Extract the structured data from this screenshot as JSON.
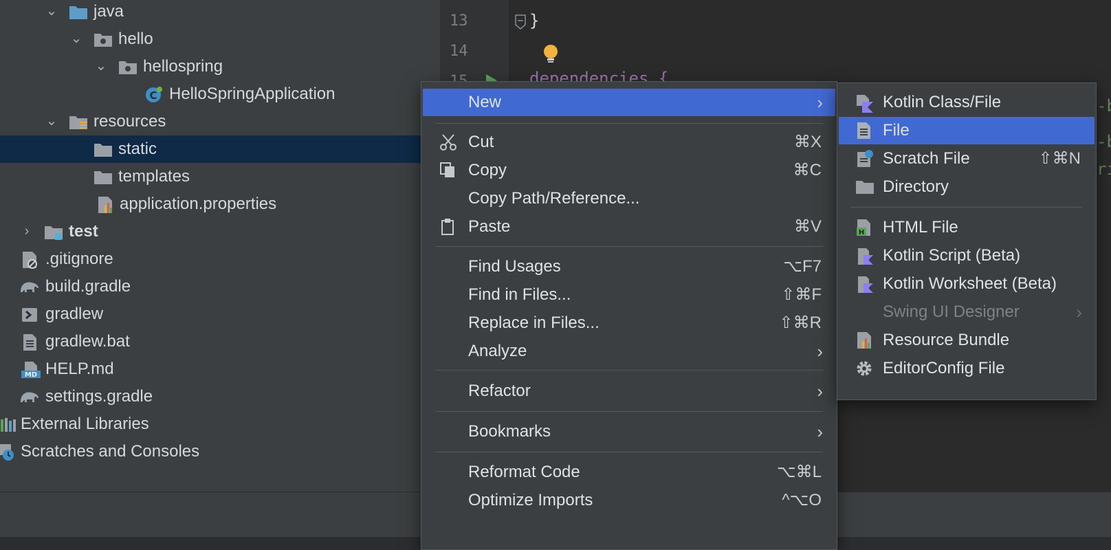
{
  "tree": [
    {
      "label": "java",
      "chev": "⌄",
      "bold": false
    },
    {
      "label": "hello",
      "chev": "⌄",
      "bold": false
    },
    {
      "label": "hellospring",
      "chev": "⌄",
      "bold": false
    },
    {
      "label": "HelloSpringApplication",
      "chev": "",
      "bold": false
    },
    {
      "label": "resources",
      "chev": "⌄",
      "bold": false
    },
    {
      "label": "static",
      "chev": "",
      "bold": false
    },
    {
      "label": "templates",
      "chev": "",
      "bold": false
    },
    {
      "label": "application.properties",
      "chev": "",
      "bold": false
    },
    {
      "label": "test",
      "chev": "›",
      "bold": true
    },
    {
      "label": ".gitignore",
      "chev": "",
      "bold": false
    },
    {
      "label": "build.gradle",
      "chev": "",
      "bold": false
    },
    {
      "label": "gradlew",
      "chev": "",
      "bold": false
    },
    {
      "label": "gradlew.bat",
      "chev": "",
      "bold": false
    },
    {
      "label": "HELP.md",
      "chev": "",
      "bold": false
    },
    {
      "label": "settings.gradle",
      "chev": "",
      "bold": false
    },
    {
      "label": "External Libraries",
      "chev": "",
      "bold": false
    },
    {
      "label": "Scratches and Consoles",
      "chev": "",
      "bold": false
    }
  ],
  "editor": {
    "lines": [
      "13",
      "14",
      "15"
    ],
    "brace": "}",
    "code15": "dependencies {",
    "right1": "-b",
    "right2": "-b",
    "right3": "ri"
  },
  "context_menu": {
    "items": [
      {
        "label": "New",
        "shortcut": "",
        "submenu": true
      },
      {
        "label": "Cut",
        "shortcut": "⌘X",
        "submenu": false
      },
      {
        "label": "Copy",
        "shortcut": "⌘C",
        "submenu": false
      },
      {
        "label": "Copy Path/Reference...",
        "shortcut": "",
        "submenu": false
      },
      {
        "label": "Paste",
        "shortcut": "⌘V",
        "submenu": false
      },
      {
        "label": "Find Usages",
        "shortcut": "⌥F7",
        "submenu": false
      },
      {
        "label": "Find in Files...",
        "shortcut": "⇧⌘F",
        "submenu": false
      },
      {
        "label": "Replace in Files...",
        "shortcut": "⇧⌘R",
        "submenu": false
      },
      {
        "label": "Analyze",
        "shortcut": "",
        "submenu": true
      },
      {
        "label": "Refactor",
        "shortcut": "",
        "submenu": true
      },
      {
        "label": "Bookmarks",
        "shortcut": "",
        "submenu": true
      },
      {
        "label": "Reformat Code",
        "shortcut": "⌥⌘L",
        "submenu": false
      },
      {
        "label": "Optimize Imports",
        "shortcut": "^⌥O",
        "submenu": false
      }
    ]
  },
  "new_submenu": {
    "items": [
      {
        "label": "Kotlin Class/File",
        "shortcut": ""
      },
      {
        "label": "File",
        "shortcut": ""
      },
      {
        "label": "Scratch File",
        "shortcut": "⇧⌘N"
      },
      {
        "label": "Directory",
        "shortcut": ""
      },
      {
        "label": "HTML File",
        "shortcut": ""
      },
      {
        "label": "Kotlin Script (Beta)",
        "shortcut": ""
      },
      {
        "label": "Kotlin Worksheet (Beta)",
        "shortcut": ""
      },
      {
        "label": "Swing UI Designer",
        "shortcut": ""
      },
      {
        "label": "Resource Bundle",
        "shortcut": ""
      },
      {
        "label": "EditorConfig File",
        "shortcut": ""
      }
    ]
  },
  "colors": {
    "highlight": "#4169d2",
    "tree_selected": "#0e2a47",
    "kotlin_purple": "#8c7ff0",
    "folder_blue": "#5e9dc8",
    "gradle_gray": "#9aa4ad"
  }
}
